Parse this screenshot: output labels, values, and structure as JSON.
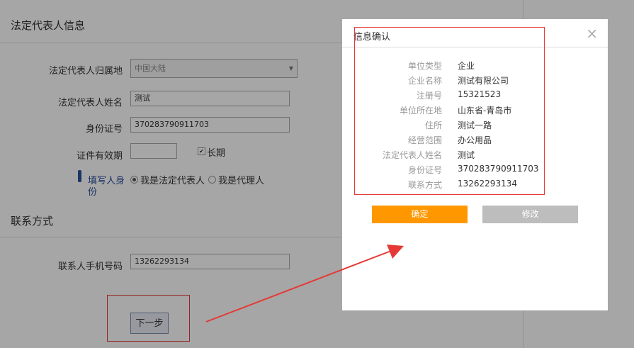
{
  "form": {
    "section_legal": "法定代表人信息",
    "region_label": "法定代表人归属地",
    "region_value": "中国大陆",
    "name_label": "法定代表人姓名",
    "name_value": "测试",
    "id_label": "身份证号",
    "id_value": "370283790911703",
    "validity_label": "证件有效期",
    "longterm_label": "长期",
    "filler_label_1": "填写人身",
    "filler_label_2": "份",
    "option_legal": "我是法定代表人",
    "option_agent": "我是代理人",
    "section_contact": "联系方式",
    "phone_label": "联系人手机号码",
    "phone_value": "13262293134",
    "next_button": "下一步"
  },
  "modal": {
    "title": "信息确认",
    "close": "×",
    "rows": [
      {
        "label": "单位类型",
        "value": "企业"
      },
      {
        "label": "企业名称",
        "value": "测试有限公司"
      },
      {
        "label": "注册号",
        "value": "15321523"
      },
      {
        "label": "单位所在地",
        "value": "山东省-青岛市"
      },
      {
        "label": "住所",
        "value": "测试一路"
      },
      {
        "label": "经营范围",
        "value": "办公用品"
      },
      {
        "label": "法定代表人姓名",
        "value": "测试"
      },
      {
        "label": "身份证号",
        "value": "370283790911703"
      },
      {
        "label": "联系方式",
        "value": "13262293134"
      }
    ],
    "confirm_button": "确定",
    "edit_button": "修改"
  },
  "colors": {
    "accent": "#ff9800",
    "annotation_red": "#e53935",
    "secondary_button": "#bdbdbd"
  },
  "icons": [
    "dropdown-caret-icon",
    "checkbox-checked-icon",
    "radio-icon",
    "close-icon",
    "arrow-annotation-icon",
    "side-marker-icon"
  ]
}
